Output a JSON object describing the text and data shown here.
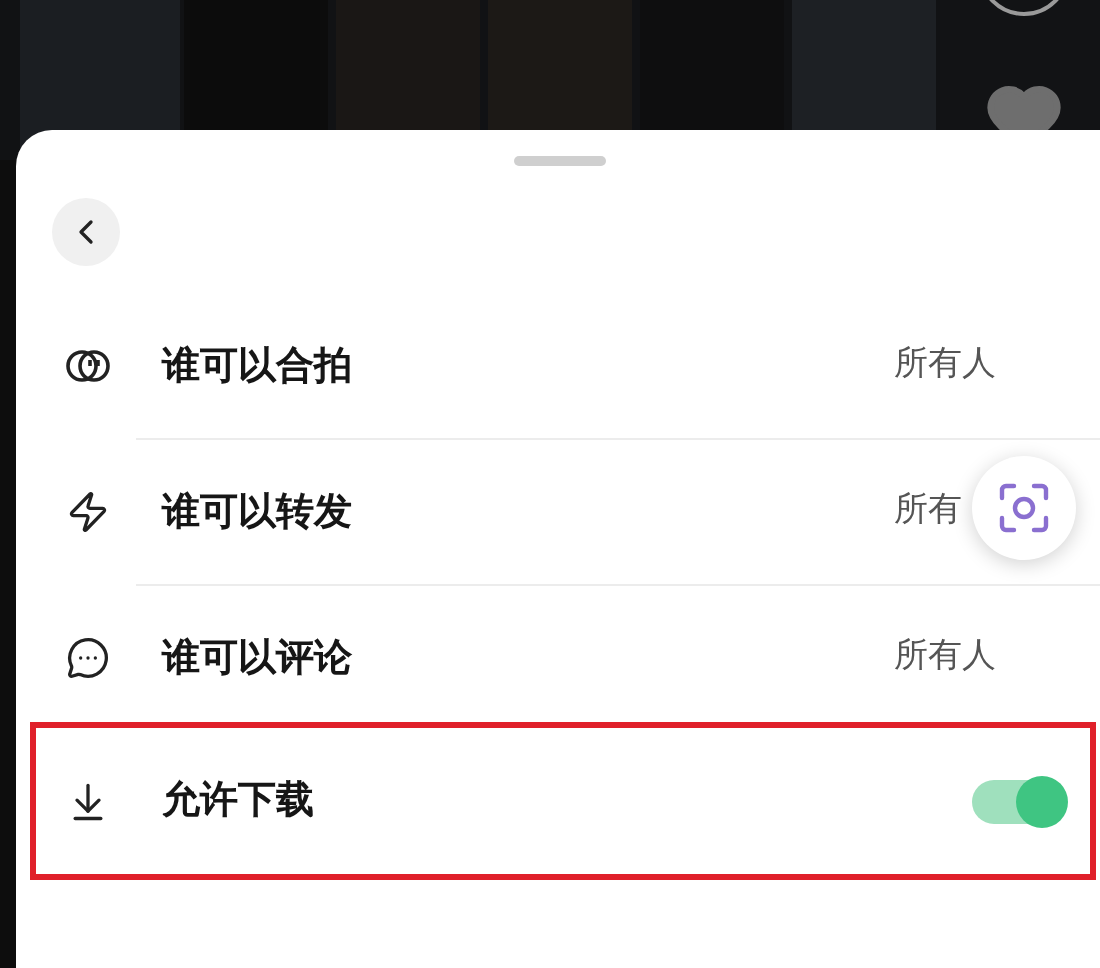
{
  "settings": [
    {
      "kind": "value",
      "label": "谁可以合拍",
      "value": "所有人",
      "highlighted": false
    },
    {
      "kind": "value",
      "label": "谁可以转发",
      "value": "所有",
      "highlighted": false
    },
    {
      "kind": "value",
      "label": "谁可以评论",
      "value": "所有人",
      "highlighted": false
    },
    {
      "kind": "toggle",
      "label": "允许下载",
      "on": true,
      "highlighted": true
    }
  ]
}
